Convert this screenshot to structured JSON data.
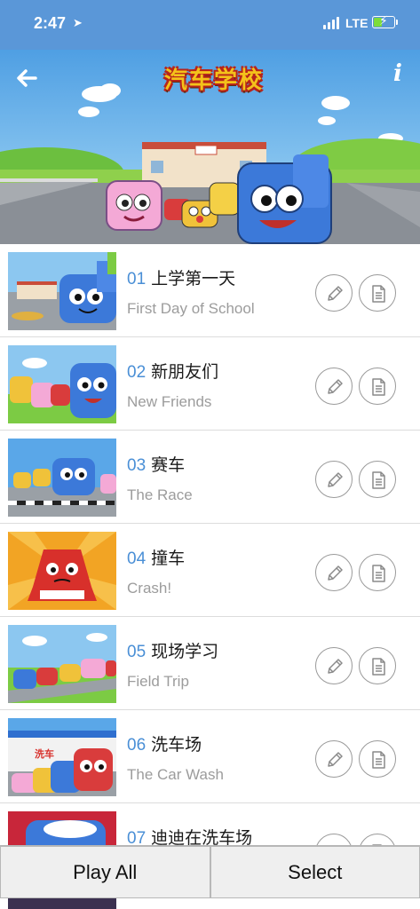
{
  "status_bar": {
    "time": "2:47",
    "network": "LTE"
  },
  "header": {
    "logo_text": "汽车学校",
    "back_icon": "arrow-left-icon",
    "info_label": "i"
  },
  "episodes": [
    {
      "number": "01",
      "title": "上学第一天",
      "subtitle": "First Day of School"
    },
    {
      "number": "02",
      "title": "新朋友们",
      "subtitle": "New Friends"
    },
    {
      "number": "03",
      "title": "赛车",
      "subtitle": "The Race"
    },
    {
      "number": "04",
      "title": "撞车",
      "subtitle": "Crash!"
    },
    {
      "number": "05",
      "title": "现场学习",
      "subtitle": "Field Trip"
    },
    {
      "number": "06",
      "title": "洗车场",
      "subtitle": "The Car Wash"
    },
    {
      "number": "07",
      "title": "迪迪在洗车场",
      "subtitle": ""
    }
  ],
  "thumbnail_text": {
    "car_wash_sign": "洗车"
  },
  "row_icons": {
    "edit": "pencil-icon",
    "doc": "document-icon"
  },
  "bottom_bar": {
    "play_all_label": "Play All",
    "select_label": "Select"
  },
  "colors": {
    "status_bar": "#5a97d8",
    "number_accent": "#4a8fd6",
    "subtitle": "#9c9c9c"
  }
}
